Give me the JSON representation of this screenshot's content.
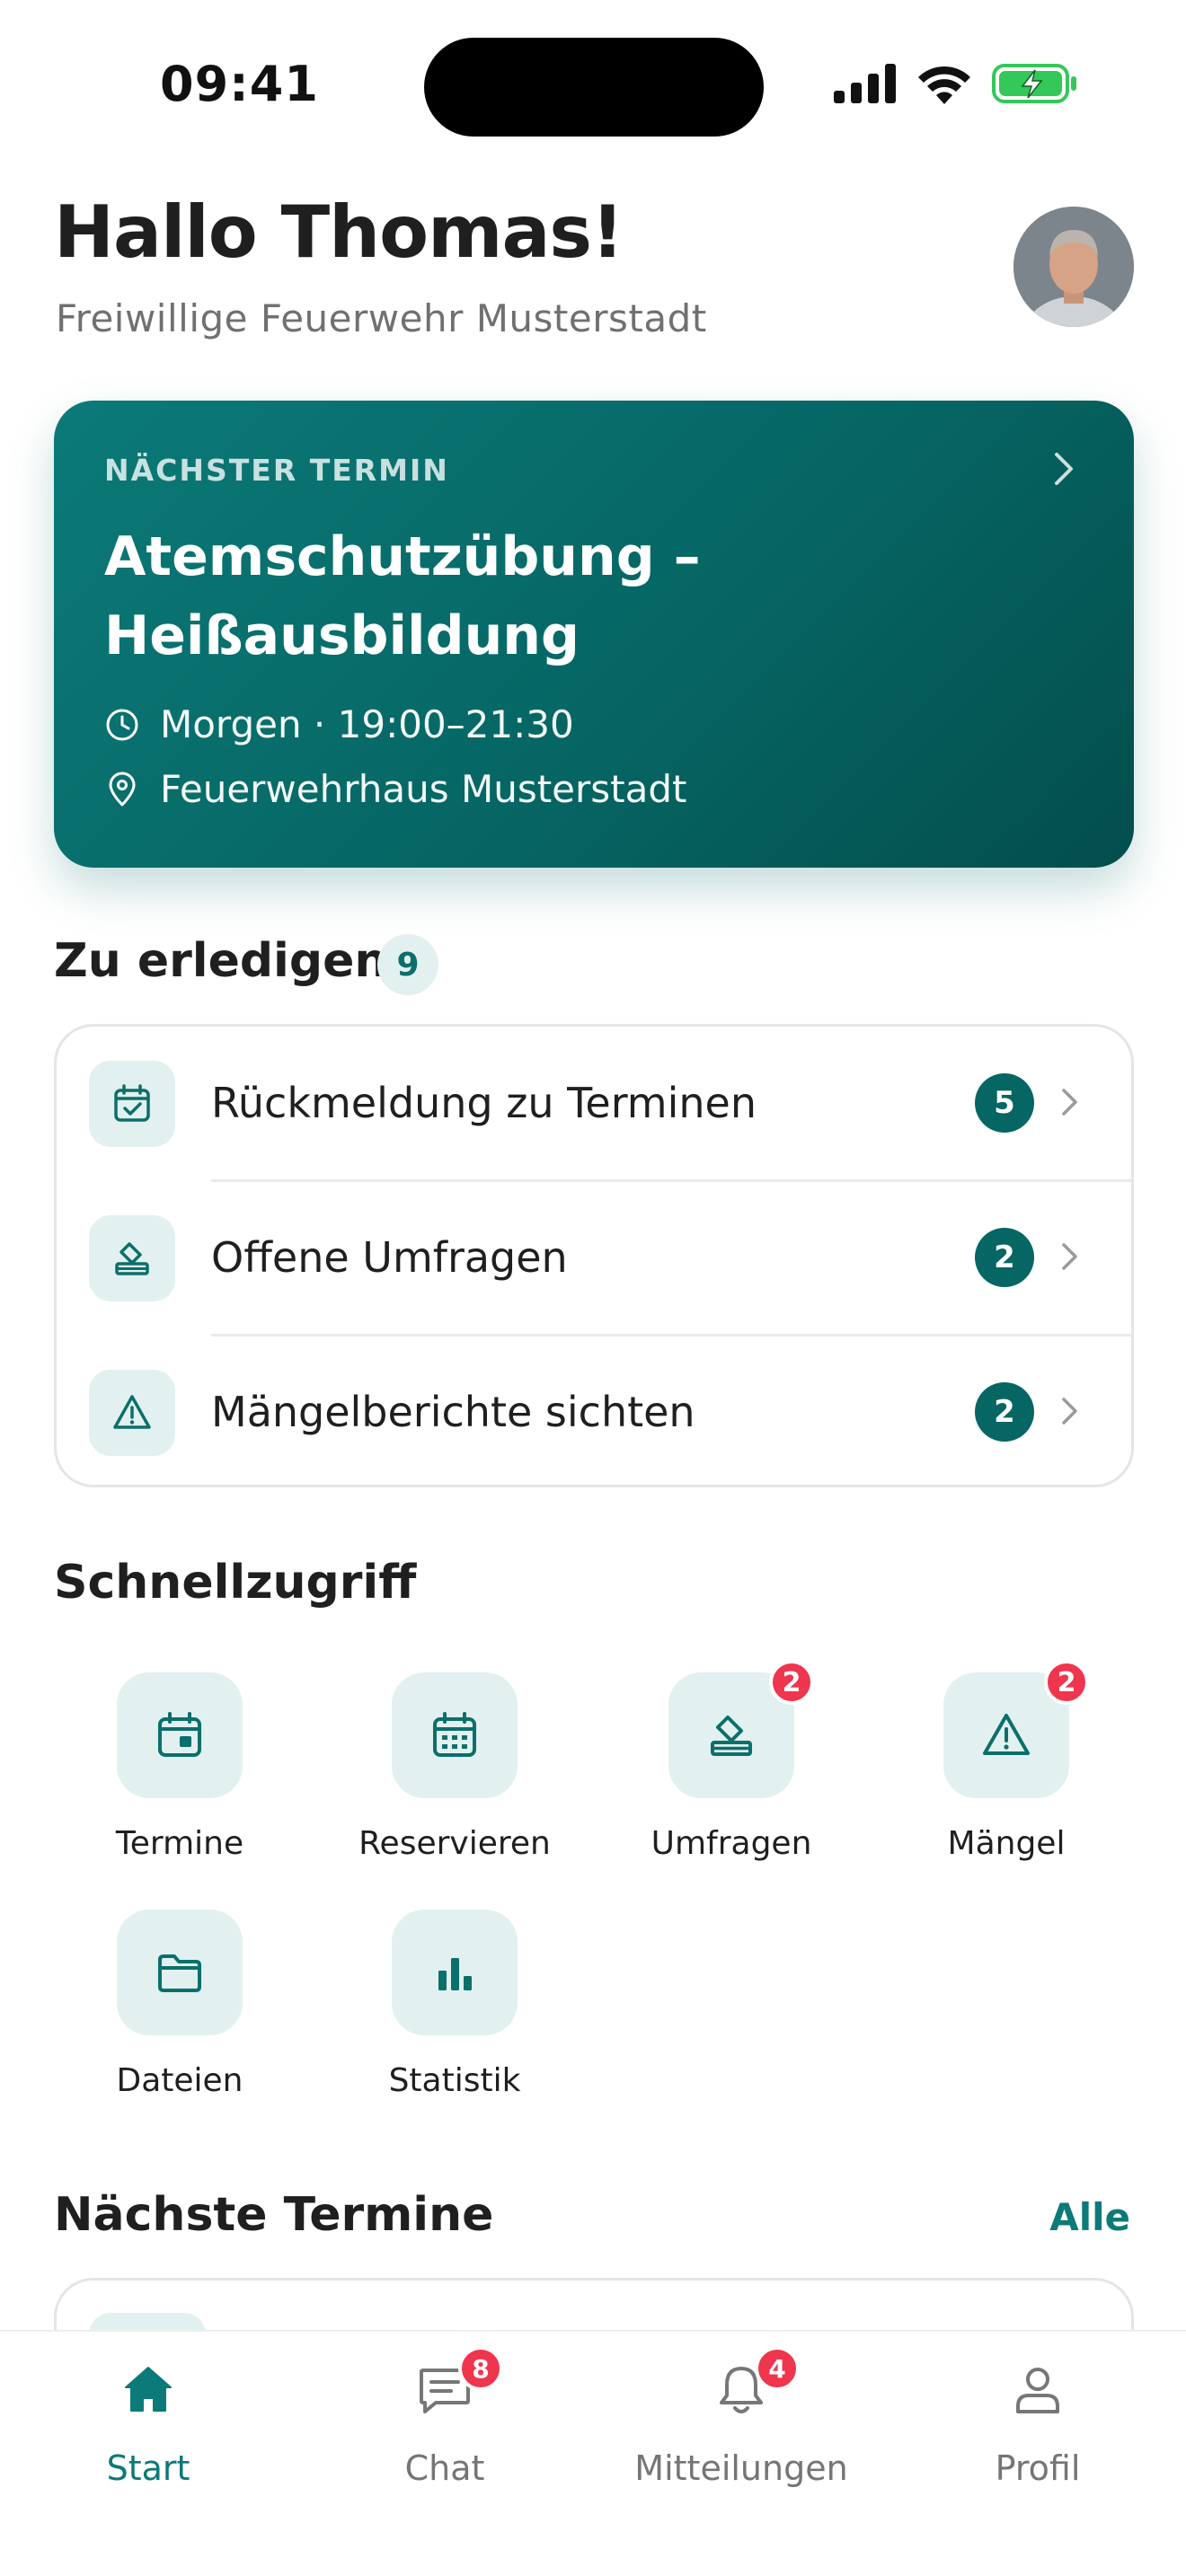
{
  "status_bar": {
    "time": "09:41"
  },
  "header": {
    "greeting": "Hallo Thomas!",
    "organization": "Freiwillige Feuerwehr Musterstadt",
    "avatar_icon": "user-avatar"
  },
  "next_event": {
    "label": "NÄCHSTER TERMIN",
    "title_line1": "Atemschutzübung –",
    "title_line2": "Heißausbildung",
    "time": "Morgen · 19:00–21:30",
    "location": "Feuerwehrhaus Musterstadt"
  },
  "todo": {
    "title": "Zu erledigen",
    "count": "9",
    "items": [
      {
        "label": "Rückmeldung zu Terminen",
        "badge": "5",
        "icon": "calendar-check-icon"
      },
      {
        "label": "Offene Umfragen",
        "badge": "2",
        "icon": "ballot-icon"
      },
      {
        "label": "Mängelberichte sichten",
        "badge": "2",
        "icon": "warning-icon"
      }
    ]
  },
  "quick_access": {
    "title": "Schnellzugriff",
    "items": [
      {
        "label": "Termine",
        "icon": "calendar-icon",
        "badge": ""
      },
      {
        "label": "Reservieren",
        "icon": "calendar-grid-icon",
        "badge": ""
      },
      {
        "label": "Umfragen",
        "icon": "ballot-icon",
        "badge": "2"
      },
      {
        "label": "Mängel",
        "icon": "warning-icon",
        "badge": "2"
      },
      {
        "label": "Dateien",
        "icon": "folder-icon",
        "badge": ""
      },
      {
        "label": "Statistik",
        "icon": "bar-chart-icon",
        "badge": ""
      }
    ]
  },
  "upcoming": {
    "title": "Nächste Termine",
    "all_link": "Alle"
  },
  "tab_bar": {
    "tabs": [
      {
        "label": "Start",
        "icon": "home-icon",
        "badge": "",
        "active": true
      },
      {
        "label": "Chat",
        "icon": "chat-icon",
        "badge": "8",
        "active": false
      },
      {
        "label": "Mitteilungen",
        "icon": "bell-icon",
        "badge": "4",
        "active": false
      },
      {
        "label": "Profil",
        "icon": "profile-icon",
        "badge": "",
        "active": false
      }
    ]
  },
  "colors": {
    "accent": "#0b7a78",
    "accent_dark": "#034e4c",
    "tile_bg": "#e2f1ef",
    "badge_red": "#f0354e"
  }
}
